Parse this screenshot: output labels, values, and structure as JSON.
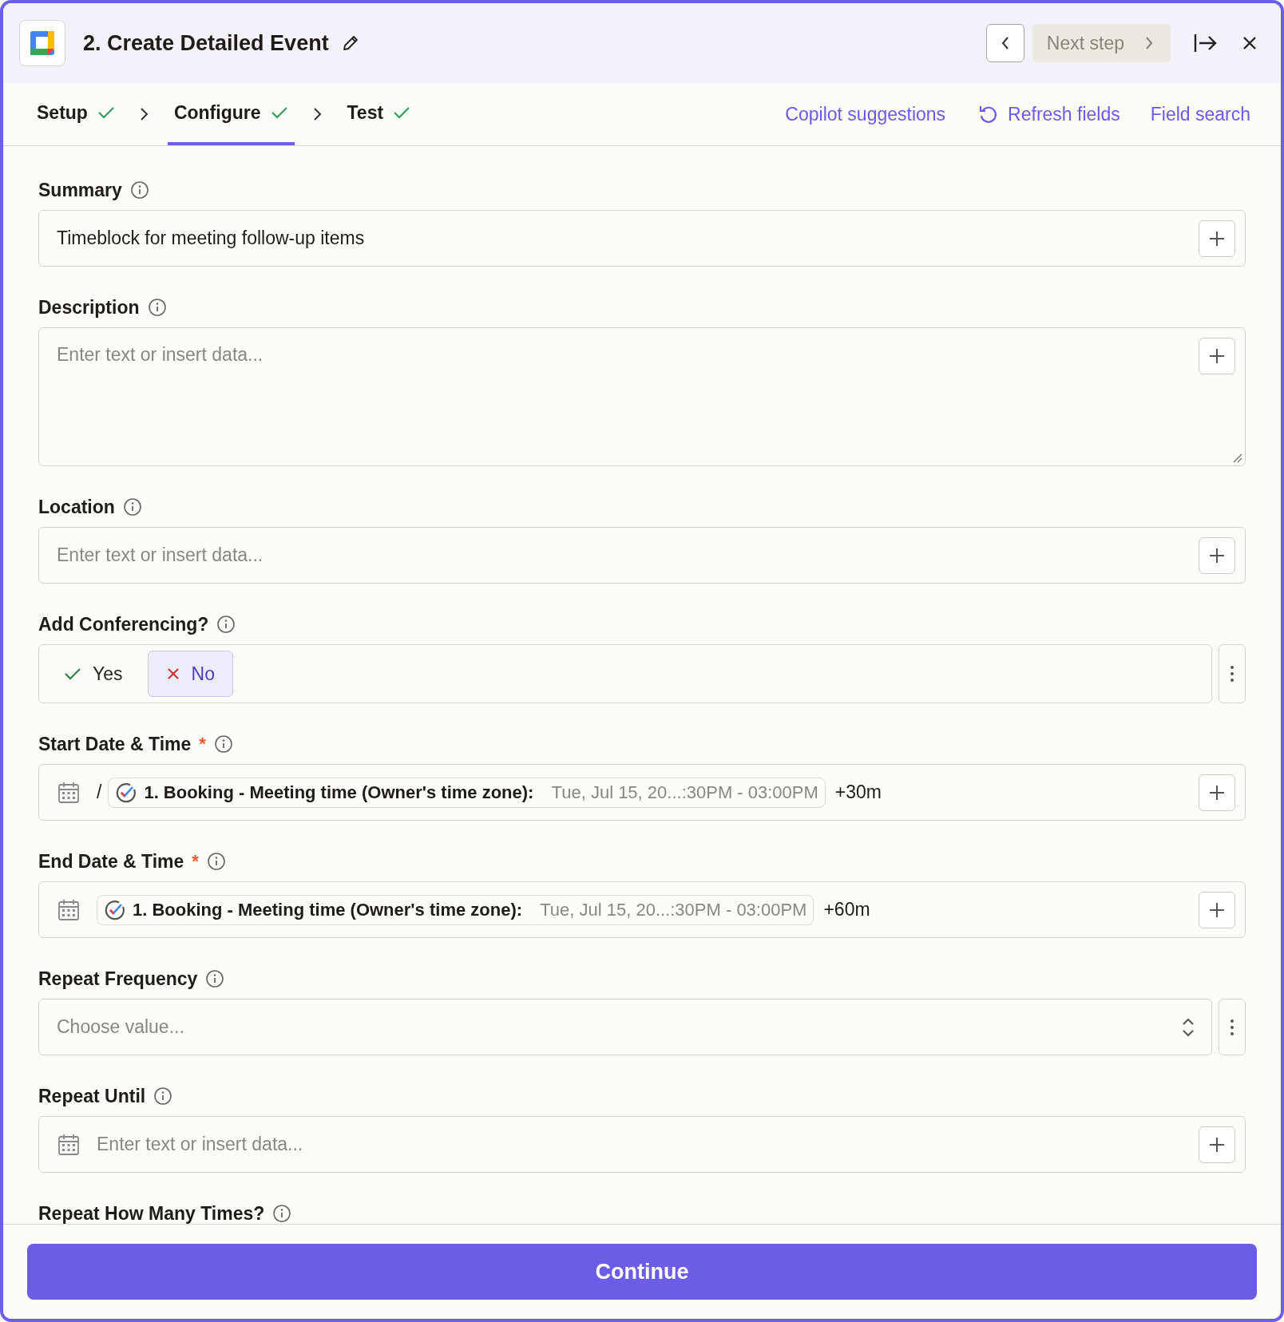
{
  "header": {
    "title": "2. Create Detailed Event",
    "next_step": "Next step"
  },
  "steps": [
    {
      "label": "Setup",
      "selected": false,
      "done": true
    },
    {
      "label": "Configure",
      "selected": true,
      "done": true
    },
    {
      "label": "Test",
      "selected": false,
      "done": true
    }
  ],
  "actions": [
    {
      "label": "Copilot suggestions",
      "kind": "link"
    },
    {
      "label": "Refresh fields",
      "kind": "refresh"
    },
    {
      "label": "Field search",
      "kind": "link"
    }
  ],
  "fields": [
    {
      "kind": "text",
      "label": "Summary",
      "value": "Timeblock for meeting follow-up items"
    },
    {
      "kind": "textarea",
      "label": "Description",
      "placeholder": "Enter text or insert data..."
    },
    {
      "kind": "text",
      "label": "Location",
      "placeholder": "Enter text or insert data..."
    },
    {
      "kind": "boolean",
      "label": "Add Conferencing?",
      "options": [
        {
          "label": "Yes",
          "kind": "yes",
          "selected": false
        },
        {
          "label": "No",
          "kind": "no",
          "selected": true
        }
      ]
    },
    {
      "kind": "datetime",
      "label": "Start Date & Time",
      "required_mark": "*",
      "prefix": "/",
      "token": {
        "step": "1. Booking - Meeting time (Owner's time zone):",
        "value": "Tue, Jul 15, 20...:30PM - 03:00PM"
      },
      "suffix": "+30m"
    },
    {
      "kind": "datetime",
      "label": "End Date & Time",
      "required_mark": "*",
      "token": {
        "step": "1. Booking - Meeting time (Owner's time zone):",
        "value": "Tue, Jul 15, 20...:30PM - 03:00PM"
      },
      "suffix": "+60m"
    },
    {
      "kind": "select",
      "label": "Repeat Frequency",
      "placeholder": "Choose value..."
    },
    {
      "kind": "date",
      "label": "Repeat Until",
      "placeholder": "Enter text or insert data..."
    },
    {
      "kind": "label",
      "label": "Repeat How Many Times?"
    }
  ],
  "continue": "Continue"
}
